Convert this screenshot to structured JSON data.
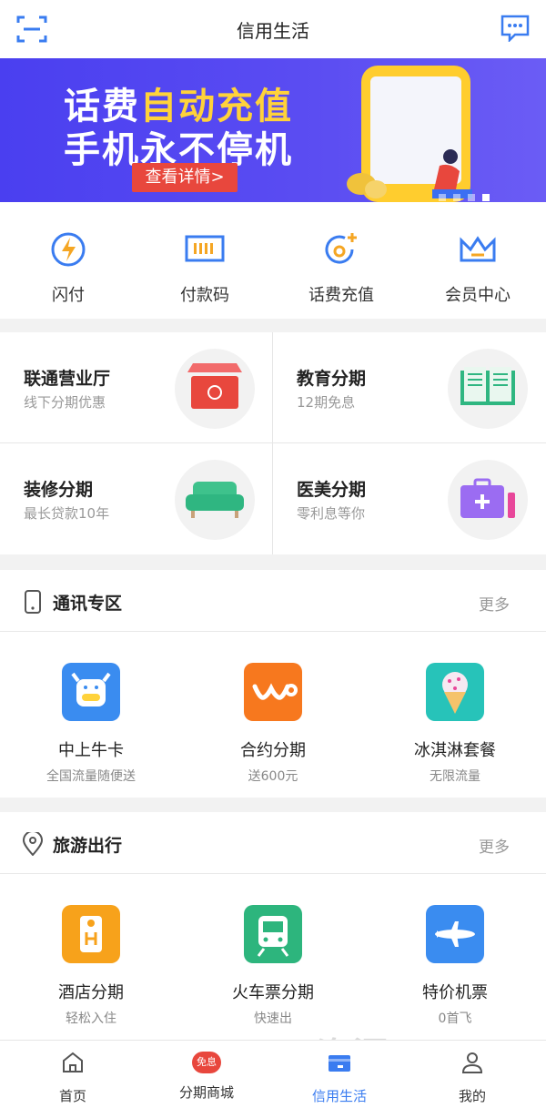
{
  "header": {
    "title": "信用生活",
    "left_icon": "scan-icon",
    "right_icon": "message-icon"
  },
  "banner": {
    "line1_part1": "话费",
    "line1_highlight": "自动充值",
    "line2": "手机永不停机",
    "cta": "查看详情>",
    "colors": {
      "background": "#4a3ff0",
      "highlight": "#ffd23a",
      "cta": "#e8473d"
    }
  },
  "quick_actions": [
    {
      "label": "闪付",
      "icon": "lightning-icon"
    },
    {
      "label": "付款码",
      "icon": "barcode-icon"
    },
    {
      "label": "话费充值",
      "icon": "recharge-icon"
    },
    {
      "label": "会员中心",
      "icon": "crown-icon"
    }
  ],
  "finance_grid": [
    {
      "title": "联通营业厅",
      "subtitle": "线下分期优惠",
      "icon": "store-icon"
    },
    {
      "title": "教育分期",
      "subtitle": "12期免息",
      "icon": "book-icon"
    },
    {
      "title": "装修分期",
      "subtitle": "最长贷款10年",
      "icon": "sofa-icon"
    },
    {
      "title": "医美分期",
      "subtitle": "零利息等你",
      "icon": "beauty-kit-icon"
    }
  ],
  "telecom": {
    "title": "通讯专区",
    "more": "更多",
    "items": [
      {
        "name": "中上牛卡",
        "desc": "全国流量随便送",
        "icon": "cow-icon",
        "color": "#3a8cf0"
      },
      {
        "name": "合约分期",
        "desc": "送600元",
        "icon": "wo-icon",
        "color": "#f7781e"
      },
      {
        "name": "冰淇淋套餐",
        "desc": "无限流量",
        "icon": "ice-cream-icon",
        "color": "#27c3b9"
      }
    ]
  },
  "travel": {
    "title": "旅游出行",
    "more": "更多",
    "items": [
      {
        "name": "酒店分期",
        "desc": "轻松入住",
        "icon": "hotel-icon",
        "color": "#f7a21b"
      },
      {
        "name": "火车票分期",
        "desc": "快速出",
        "icon": "train-icon",
        "color": "#2db57d"
      },
      {
        "name": "特价机票",
        "desc": "0首飞",
        "icon": "plane-icon",
        "color": "#3a8cf0"
      }
    ]
  },
  "tabbar": [
    {
      "label": "首页",
      "icon": "home-icon",
      "active": false
    },
    {
      "label": "分期商城",
      "icon": "mall-icon",
      "active": false
    },
    {
      "label": "信用生活",
      "icon": "credit-card-icon",
      "active": true
    },
    {
      "label": "我的",
      "icon": "user-icon",
      "active": false
    }
  ],
  "mall_badge": "免息",
  "watermark": "BOSS 资源"
}
